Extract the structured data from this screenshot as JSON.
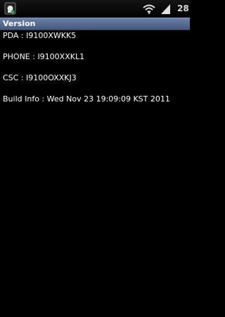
{
  "status_bar": {
    "notification_icon": "usb-debug-android-icon",
    "wifi_icon": "wifi-icon",
    "signal_icon": "signal-icon",
    "time": "28"
  },
  "title_bar": {
    "title": "Version"
  },
  "info": {
    "pda": "PDA : I9100XWKK5",
    "phone": "PHONE : I9100XXKL1",
    "csc": "CSC : I9100OXXKJ3",
    "build": "Build Info : Wed Nov 23 19:09:09 KST 2011"
  },
  "colors": {
    "background": "#000000",
    "title_bar": "#5a6f96",
    "text": "#ffffff"
  }
}
